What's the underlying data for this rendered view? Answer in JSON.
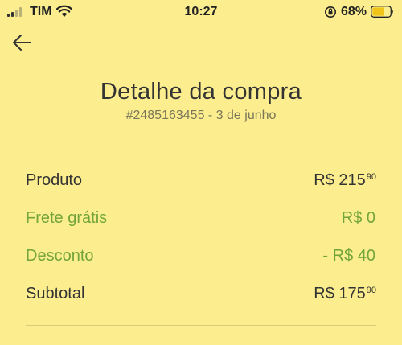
{
  "status_bar": {
    "carrier": "TIM",
    "time": "10:27",
    "battery_percent": "68%",
    "battery_level": 0.68,
    "icons": [
      "signal-icon",
      "wifi-icon",
      "orientation-lock-icon",
      "battery-icon"
    ]
  },
  "header": {
    "back_icon": "arrow-left-icon",
    "title": "Detalhe da compra",
    "subtitle": "#2485163455 - 3 de junho"
  },
  "summary": {
    "product": {
      "label": "Produto",
      "value": "R$ 215",
      "cents": "90"
    },
    "shipping": {
      "label": "Frete grátis",
      "value": "R$ 0",
      "cents": ""
    },
    "discount": {
      "label": "Desconto",
      "value": "- R$ 40",
      "cents": ""
    },
    "subtotal": {
      "label": "Subtotal",
      "value": "R$ 175",
      "cents": "90"
    }
  },
  "colors": {
    "background": "#FCEE8E",
    "text": "#333333",
    "accent_green": "#72A43A",
    "muted": "#7A7558"
  }
}
